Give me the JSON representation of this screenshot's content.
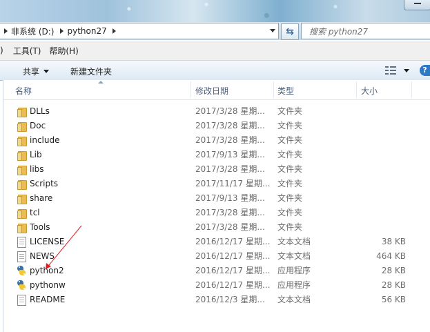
{
  "address": {
    "crumbs": [
      "非系统 (D:)",
      "python27"
    ],
    "search_placeholder": "搜索 python27"
  },
  "menu": {
    "items": [
      ")",
      "工具(T)",
      "帮助(H)"
    ]
  },
  "command_bar": {
    "share_label": "共享",
    "new_folder_label": "新建文件夹"
  },
  "columns": {
    "name": "名称",
    "date": "修改日期",
    "type": "类型",
    "size": "大小"
  },
  "files": [
    {
      "name": "DLLs",
      "date": "2017/3/28 星期...",
      "type": "文件夹",
      "size": "",
      "icon": "folder-icon"
    },
    {
      "name": "Doc",
      "date": "2017/3/28 星期...",
      "type": "文件夹",
      "size": "",
      "icon": "folder-icon"
    },
    {
      "name": "include",
      "date": "2017/3/28 星期...",
      "type": "文件夹",
      "size": "",
      "icon": "folder-icon"
    },
    {
      "name": "Lib",
      "date": "2017/9/13 星期...",
      "type": "文件夹",
      "size": "",
      "icon": "folder-icon"
    },
    {
      "name": "libs",
      "date": "2017/3/28 星期...",
      "type": "文件夹",
      "size": "",
      "icon": "folder-icon"
    },
    {
      "name": "Scripts",
      "date": "2017/11/17 星期...",
      "type": "文件夹",
      "size": "",
      "icon": "folder-icon"
    },
    {
      "name": "share",
      "date": "2017/9/13 星期...",
      "type": "文件夹",
      "size": "",
      "icon": "folder-icon"
    },
    {
      "name": "tcl",
      "date": "2017/3/28 星期...",
      "type": "文件夹",
      "size": "",
      "icon": "folder-icon"
    },
    {
      "name": "Tools",
      "date": "2017/3/28 星期...",
      "type": "文件夹",
      "size": "",
      "icon": "folder-icon"
    },
    {
      "name": "LICENSE",
      "date": "2016/12/17 星期...",
      "type": "文本文档",
      "size": "38 KB",
      "icon": "text-document-icon"
    },
    {
      "name": "NEWS",
      "date": "2016/12/17 星期...",
      "type": "文本文档",
      "size": "464 KB",
      "icon": "text-document-icon"
    },
    {
      "name": "python2",
      "date": "2016/12/17 星期...",
      "type": "应用程序",
      "size": "28 KB",
      "icon": "python-icon"
    },
    {
      "name": "pythonw",
      "date": "2016/12/17 星期...",
      "type": "应用程序",
      "size": "28 KB",
      "icon": "python-icon"
    },
    {
      "name": "README",
      "date": "2016/12/3 星期...",
      "type": "文本文档",
      "size": "56 KB",
      "icon": "text-document-icon"
    }
  ],
  "colors": {
    "annotation_arrow": "#e02020",
    "folder": "#e9bd52",
    "python_blue": "#3a72a8",
    "python_yellow": "#f2c832"
  }
}
